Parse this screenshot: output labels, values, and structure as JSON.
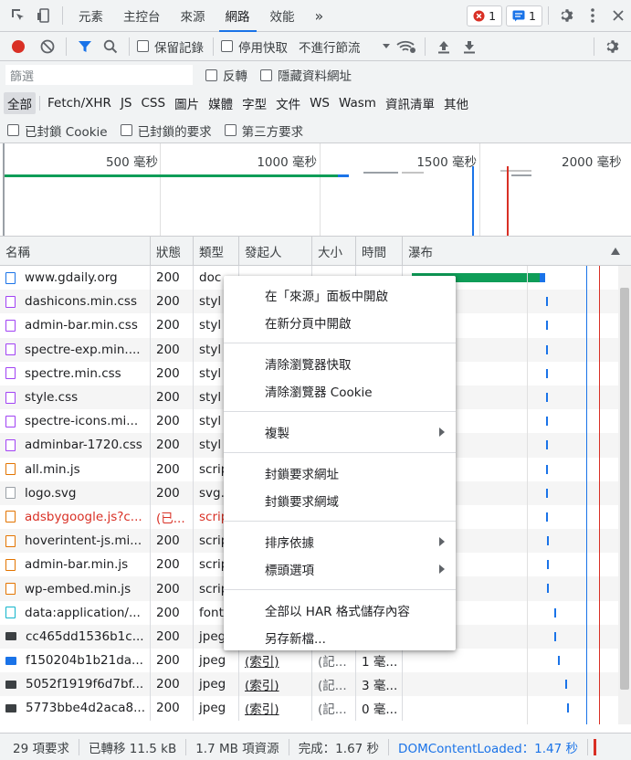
{
  "toolbar": {
    "tabs": [
      "元素",
      "主控台",
      "來源",
      "網路",
      "效能"
    ],
    "active_tab": "網路",
    "more": "»",
    "errors_count": "1",
    "messages_count": "1"
  },
  "network_toolbar": {
    "preserve_log": "保留記錄",
    "disable_cache": "停用快取",
    "throttling": "不進行節流"
  },
  "filter": {
    "placeholder": "篩選",
    "invert": "反轉",
    "hide_data_urls": "隱藏資料網址"
  },
  "type_filters": [
    "全部",
    "Fetch/XHR",
    "JS",
    "CSS",
    "圖片",
    "媒體",
    "字型",
    "文件",
    "WS",
    "Wasm",
    "資訊清單",
    "其他"
  ],
  "block_filters": [
    "已封鎖 Cookie",
    "已封鎖的要求",
    "第三方要求"
  ],
  "overview": {
    "ticks": [
      "500 毫秒",
      "1000 毫秒",
      "1500 毫秒",
      "2000 毫秒"
    ]
  },
  "table": {
    "headers": [
      "名稱",
      "狀態",
      "類型",
      "發起人",
      "大小",
      "時間",
      "瀑布"
    ],
    "rows": [
      {
        "name": "www.gdaily.org",
        "status": "200",
        "type": "doc",
        "kind": "doc"
      },
      {
        "name": "dashicons.min.css",
        "status": "200",
        "type": "styl",
        "kind": "css"
      },
      {
        "name": "admin-bar.min.css",
        "status": "200",
        "type": "styl",
        "kind": "css"
      },
      {
        "name": "spectre-exp.min....",
        "status": "200",
        "type": "styl",
        "kind": "css"
      },
      {
        "name": "spectre.min.css",
        "status": "200",
        "type": "styl",
        "kind": "css"
      },
      {
        "name": "style.css",
        "status": "200",
        "type": "styl",
        "kind": "css"
      },
      {
        "name": "spectre-icons.mi...",
        "status": "200",
        "type": "styl",
        "kind": "css"
      },
      {
        "name": "adminbar-1720.css",
        "status": "200",
        "type": "styl",
        "kind": "css"
      },
      {
        "name": "all.min.js",
        "status": "200",
        "type": "scrip",
        "kind": "js"
      },
      {
        "name": "logo.svg",
        "status": "200",
        "type": "svg.",
        "kind": "svg"
      },
      {
        "name": "adsbygoogle.js?c...",
        "status": "(已...",
        "type": "scrip",
        "kind": "js",
        "error": true
      },
      {
        "name": "hoverintent-js.mi...",
        "status": "200",
        "type": "scrip",
        "kind": "js"
      },
      {
        "name": "admin-bar.min.js",
        "status": "200",
        "type": "scrip",
        "kind": "js"
      },
      {
        "name": "wp-embed.min.js",
        "status": "200",
        "type": "scrip",
        "kind": "js"
      },
      {
        "name": "data:application/...",
        "status": "200",
        "type": "font",
        "kind": "font"
      },
      {
        "name": "cc465dd1536b1c...",
        "status": "200",
        "type": "jpeg",
        "kind": "jpeg"
      },
      {
        "name": "f150204b1b21da...",
        "status": "200",
        "type": "jpeg",
        "kind": "jpeg2",
        "initiator": "(索引)",
        "size": "(記...",
        "time": "1 毫..."
      },
      {
        "name": "5052f1919f6d7bf...",
        "status": "200",
        "type": "jpeg",
        "kind": "jpeg",
        "initiator": "(索引)",
        "size": "(記...",
        "time": "3 毫..."
      },
      {
        "name": "5773bbe4d2aca8...",
        "status": "200",
        "type": "jpeg",
        "kind": "jpeg",
        "initiator": "(索引)",
        "size": "(記...",
        "time": "0 毫..."
      }
    ]
  },
  "context_menu": {
    "groups": [
      [
        "在「來源」面板中開啟",
        "在新分頁中開啟"
      ],
      [
        "清除瀏覽器快取",
        "清除瀏覽器 Cookie"
      ],
      [
        "複製"
      ],
      [
        "封鎖要求網址",
        "封鎖要求網域"
      ],
      [
        "排序依據",
        "標頭選項"
      ],
      [
        "全部以 HAR 格式儲存內容",
        "另存新檔..."
      ]
    ]
  },
  "status_bar": [
    "29 項要求",
    "已轉移 11.5 kB",
    "1.7 MB 項資源",
    "完成：1.67 秒",
    "DOMContentLoaded：1.47 秒"
  ],
  "colors": {
    "accent": "#1a73e8",
    "error": "#d93025",
    "record": "#d93025",
    "green": "#0f9d58"
  }
}
